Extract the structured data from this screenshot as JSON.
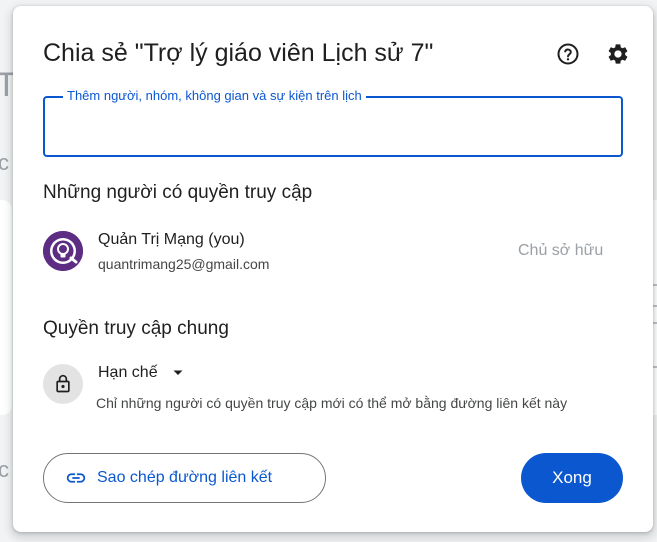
{
  "dialog": {
    "title": "Chia sẻ \"Trợ lý giáo viên Lịch sử 7\""
  },
  "icons": {
    "help": "help-circle-icon",
    "settings": "gear-icon",
    "lock": "lock-icon",
    "dropdown": "caret-down-icon",
    "link": "link-icon"
  },
  "share_input": {
    "label": "Thêm người, nhóm, không gian và sự kiện trên lịch",
    "value": ""
  },
  "access_section": {
    "heading": "Những người có quyền truy cập",
    "people": [
      {
        "name": "Quản Trị Mạng (you)",
        "email": "quantrimang25@gmail.com",
        "role": "Chủ sở hữu"
      }
    ]
  },
  "general_access": {
    "heading": "Quyền truy cập chung",
    "selected": "Hạn chế",
    "description": "Chỉ những người có quyền truy cập mới có thể mở bằng đường liên kết này"
  },
  "footer": {
    "copy_link_label": "Sao chép đường liên kết",
    "done_label": "Xong"
  },
  "colors": {
    "accent": "#0b57d0",
    "avatar": "#5c2d83"
  }
}
